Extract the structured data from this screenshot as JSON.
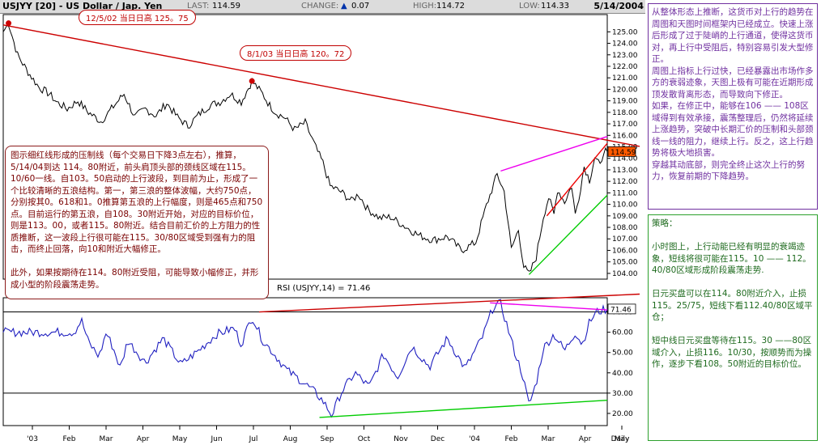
{
  "header": {
    "symbol": "USJYY [20] - US Dollar / Jap. Yen",
    "last_label": "LAST:",
    "last_value": "114.59",
    "change_label": "CHANGE:",
    "change_arrow": "▲",
    "change_value": "0.07",
    "high_label": "HIGH:",
    "high_value": "114.72",
    "low_label": "LOW:",
    "low_value": "114.33",
    "date": "5/14/2004"
  },
  "annotations": {
    "peak_1": "12/5/02 当日日高 125。75",
    "peak_2": "8/1/03 当日日高 120。72",
    "rsi_label": "RSI (USJYY,14) = 71.46"
  },
  "notes": {
    "top_right": "从整体形态上推断，这货币对上行的趋势在周图和天图时间框架内已经成立。快速上涨后形成了过于陡峭的上行通道，使得这货币对，再上行中受阻后，特别容易引发大型修正。\n周图上指标上行过快，已经暴露出市场作多方的衰弱迹象，天图上极有可能在近期形成顶发散背离形态，而导致向下修正。\n如果，在修正中，能够在106 —— 108区域得到有效承接，震荡整理后，仍然将延续上涨趋势，突破中长期汇价的压制和头部颈线一线的阻力，继续上行。反之，这上行趋势将极大地损害。\n 穿越其动底部，则完全终止这次上行的努力，恢复前期的下降趋势。",
    "main": "图示细红线形成的压制线（每个交易日下降3点左右），推算，5/14/04到达 114。80附近，前头肩顶头部的颈线区域在115。10/60一线。自103。50启动的上行波段，到目前为止，形成了一个比较清晰的五浪结构。第一，第三浪的整体波幅，大约750点，分别按其0。618和1。0推算第五浪的上行幅度，则是465点和750点。目前运行的第五浪，自108。30附近开始，对应的目标价位，则是113。00，或者115。80附近。结合目前汇价的上方阻力的性质推断，这一波段上行很可能在115。30/80区域受到强有力的阻击，而终止回落，向10和附近大幅修正。\n\n此外，如果按期待在114。80附近受阻，可能导致小幅修正，并形成小型的阶段震荡走势。",
    "strategy": "策略：\n\n小时图上，上行动能已经有明显的衰竭迹象，短线将很可能在115。10 —— 112。40/80区域形成阶段震荡走势.\n\n日元买盘可以在114。80附近介入，止损115。25/75，短线下看112.40/80区域平仓；\n\n短中线日元买盘等待在115。30 ——80区域介入，止损116。10/30，按顺势而为操作，逐步下看108。50附近的目标价位。"
  },
  "colors": {
    "price": "#000000",
    "rsi": "#2020c0",
    "resistance": "#cc0000",
    "channel_upper": "#ee00ee",
    "channel_lower": "#00cc00",
    "channel_red": "#ee0000",
    "purple_note": "#7030a0",
    "green_note": "#2ca02c"
  },
  "chart_data": [
    {
      "type": "line",
      "title": "USJYY [20] - US Dollar / Jap. Yen",
      "ylim": [
        103.5,
        126.5
      ],
      "y_ticks": [
        "104.00",
        "105.00",
        "106.00",
        "107.00",
        "108.00",
        "109.00",
        "110.00",
        "111.00",
        "112.00",
        "113.00",
        "114.00",
        "115.00",
        "116.00",
        "117.00",
        "118.00",
        "119.00",
        "120.00",
        "121.00",
        "122.00",
        "123.00",
        "124.00",
        "125.00"
      ],
      "x_tick_labels": [
        "'03",
        "Feb",
        "Mar",
        "Apr",
        "May",
        "Jun",
        "Jul",
        "Aug",
        "Sep",
        "Oct",
        "Nov",
        "Dec",
        "'04",
        "Feb",
        "Mar",
        "Apr",
        "May",
        "Daily"
      ],
      "last_value": "114.59",
      "x_range": [
        0,
        340
      ],
      "anchors_x": [
        0,
        3,
        8,
        14,
        20,
        26,
        30,
        36,
        42,
        48,
        55,
        62,
        68,
        74,
        80,
        86,
        92,
        98,
        104,
        110,
        116,
        122,
        128,
        134,
        140,
        146,
        150,
        154,
        158,
        164,
        170,
        176,
        180,
        184,
        190,
        196,
        200,
        205,
        212,
        218,
        226,
        234,
        242,
        250,
        258,
        266,
        272,
        278,
        282,
        284,
        286,
        290,
        293,
        296,
        300,
        304,
        307,
        310,
        312,
        316,
        320,
        322,
        324,
        327,
        330,
        333,
        336,
        338,
        340
      ],
      "anchors_y": [
        125.0,
        125.75,
        123.0,
        121.5,
        120.2,
        119.6,
        118.9,
        118.3,
        119.0,
        118.0,
        117.2,
        118.5,
        119.6,
        117.6,
        118.3,
        117.7,
        118.8,
        117.6,
        116.8,
        117.8,
        118.6,
        118.9,
        119.6,
        118.9,
        120.72,
        119.6,
        118.6,
        117.9,
        117.6,
        116.5,
        117.1,
        114.9,
        113.6,
        111.6,
        111.1,
        110.3,
        110.9,
        109.6,
        108.8,
        108.9,
        108.1,
        107.3,
        106.9,
        107.2,
        106.0,
        106.7,
        109.9,
        112.6,
        111.1,
        108.7,
        106.1,
        107.8,
        104.6,
        103.9,
        105.4,
        108.9,
        110.6,
        109.1,
        111.3,
        110.2,
        111.6,
        109.1,
        110.6,
        113.3,
        112.1,
        114.1,
        113.3,
        114.7,
        114.59
      ],
      "trendlines": [
        {
          "x": [
            0,
            340
          ],
          "y": [
            125.6,
            114.9
          ]
        },
        {
          "x": [
            280,
            340
          ],
          "y": [
            112.9,
            115.9
          ]
        },
        {
          "x": [
            296,
            340
          ],
          "y": [
            103.9,
            110.8
          ]
        },
        {
          "x": [
            306,
            340
          ],
          "y": [
            109.0,
            115.3
          ]
        }
      ]
    },
    {
      "type": "line",
      "title": "RSI (USJYY,14) = 71.46",
      "ylim": [
        14,
        77
      ],
      "y_ticks": [
        "20.00",
        "30.00",
        "40.00",
        "50.00",
        "60.00",
        "70.00"
      ],
      "horizontal_lines": [
        30,
        70
      ],
      "last_value": "71.46",
      "x_range": [
        0,
        340
      ],
      "anchors_x": [
        0,
        40,
        44,
        48,
        54,
        58,
        62,
        66,
        70,
        80,
        90,
        100,
        110,
        120,
        130,
        134,
        140,
        146,
        150,
        160,
        168,
        176,
        180,
        185,
        190,
        198,
        206,
        214,
        222,
        230,
        240,
        250,
        260,
        270,
        276,
        280,
        284,
        288,
        292,
        296,
        300,
        304,
        310,
        316,
        322,
        326,
        330,
        334,
        340
      ],
      "anchors_y": [
        60.0,
        60.0,
        66.0,
        55.0,
        48.0,
        60.0,
        52.0,
        42.0,
        56.0,
        45.0,
        57.0,
        44.0,
        51.0,
        59.0,
        62.0,
        54.0,
        68.0,
        56.0,
        52.0,
        41.0,
        36.0,
        30.0,
        26.0,
        19.0,
        30.0,
        40.0,
        33.0,
        49.0,
        38.0,
        53.0,
        43.0,
        57.0,
        42.0,
        58.0,
        73.0,
        74.0,
        62.0,
        50.0,
        40.0,
        24.0,
        35.0,
        52.0,
        59.0,
        51.0,
        60.0,
        54.0,
        65.0,
        70.0,
        71.46
      ],
      "trendlines": [
        {
          "x": [
            144,
            340
          ],
          "y": [
            70.0,
            78.0
          ]
        },
        {
          "x": [
            274,
            340
          ],
          "y": [
            74.5,
            71.0
          ]
        },
        {
          "x": [
            178,
            340
          ],
          "y": [
            18.0,
            26.5
          ]
        }
      ]
    }
  ]
}
